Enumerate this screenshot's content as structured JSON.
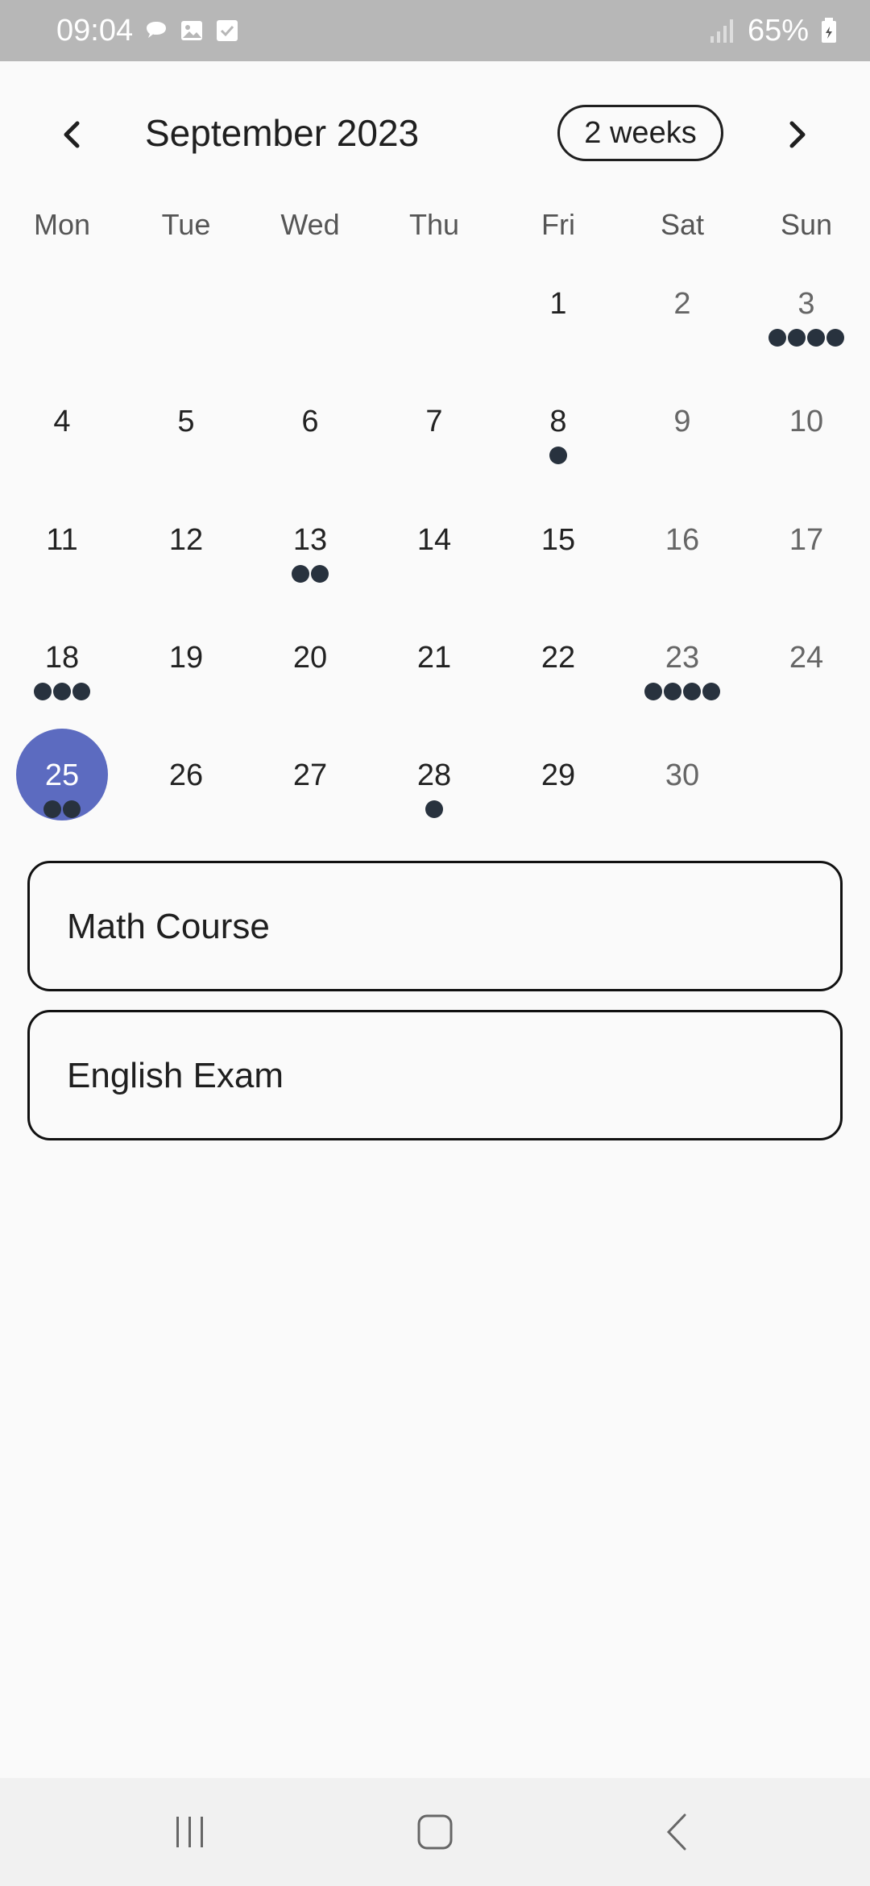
{
  "status_bar": {
    "time": "09:04",
    "battery": "65%",
    "left_icons": [
      "chat-bubble-icon",
      "image-icon",
      "checkbox-icon"
    ],
    "right_icons": [
      "signal-icon",
      "battery-icon"
    ]
  },
  "header": {
    "month": "September 2023",
    "format_button": "2 weeks",
    "prev_icon": "chevron-left-icon",
    "next_icon": "chevron-right-icon"
  },
  "weekdays": [
    "Mon",
    "Tue",
    "Wed",
    "Thu",
    "Fri",
    "Sat",
    "Sun"
  ],
  "weeks": [
    [
      {
        "day": "",
        "events": 0
      },
      {
        "day": "",
        "events": 0
      },
      {
        "day": "",
        "events": 0
      },
      {
        "day": "",
        "events": 0
      },
      {
        "day": "1",
        "events": 0
      },
      {
        "day": "2",
        "events": 0
      },
      {
        "day": "3",
        "events": 4
      }
    ],
    [
      {
        "day": "4",
        "events": 0
      },
      {
        "day": "5",
        "events": 0
      },
      {
        "day": "6",
        "events": 0
      },
      {
        "day": "7",
        "events": 0
      },
      {
        "day": "8",
        "events": 1
      },
      {
        "day": "9",
        "events": 0
      },
      {
        "day": "10",
        "events": 0
      }
    ],
    [
      {
        "day": "11",
        "events": 0
      },
      {
        "day": "12",
        "events": 0
      },
      {
        "day": "13",
        "events": 2
      },
      {
        "day": "14",
        "events": 0
      },
      {
        "day": "15",
        "events": 0
      },
      {
        "day": "16",
        "events": 0
      },
      {
        "day": "17",
        "events": 0
      }
    ],
    [
      {
        "day": "18",
        "events": 3
      },
      {
        "day": "19",
        "events": 0
      },
      {
        "day": "20",
        "events": 0
      },
      {
        "day": "21",
        "events": 0
      },
      {
        "day": "22",
        "events": 0
      },
      {
        "day": "23",
        "events": 4
      },
      {
        "day": "24",
        "events": 0
      }
    ],
    [
      {
        "day": "25",
        "events": 2
      },
      {
        "day": "26",
        "events": 0
      },
      {
        "day": "27",
        "events": 0
      },
      {
        "day": "28",
        "events": 1
      },
      {
        "day": "29",
        "events": 0
      },
      {
        "day": "30",
        "events": 0
      },
      {
        "day": "",
        "events": 0
      }
    ]
  ],
  "selected_day": "25",
  "colors": {
    "selected": "#5c6bc0",
    "marker": "#28323e",
    "background": "#fafafa"
  },
  "events": [
    {
      "title": "Math Course"
    },
    {
      "title": "English Exam"
    }
  ],
  "nav_bar": {
    "recents_icon": "recents-icon",
    "home_icon": "home-icon",
    "back_icon": "back-icon"
  }
}
